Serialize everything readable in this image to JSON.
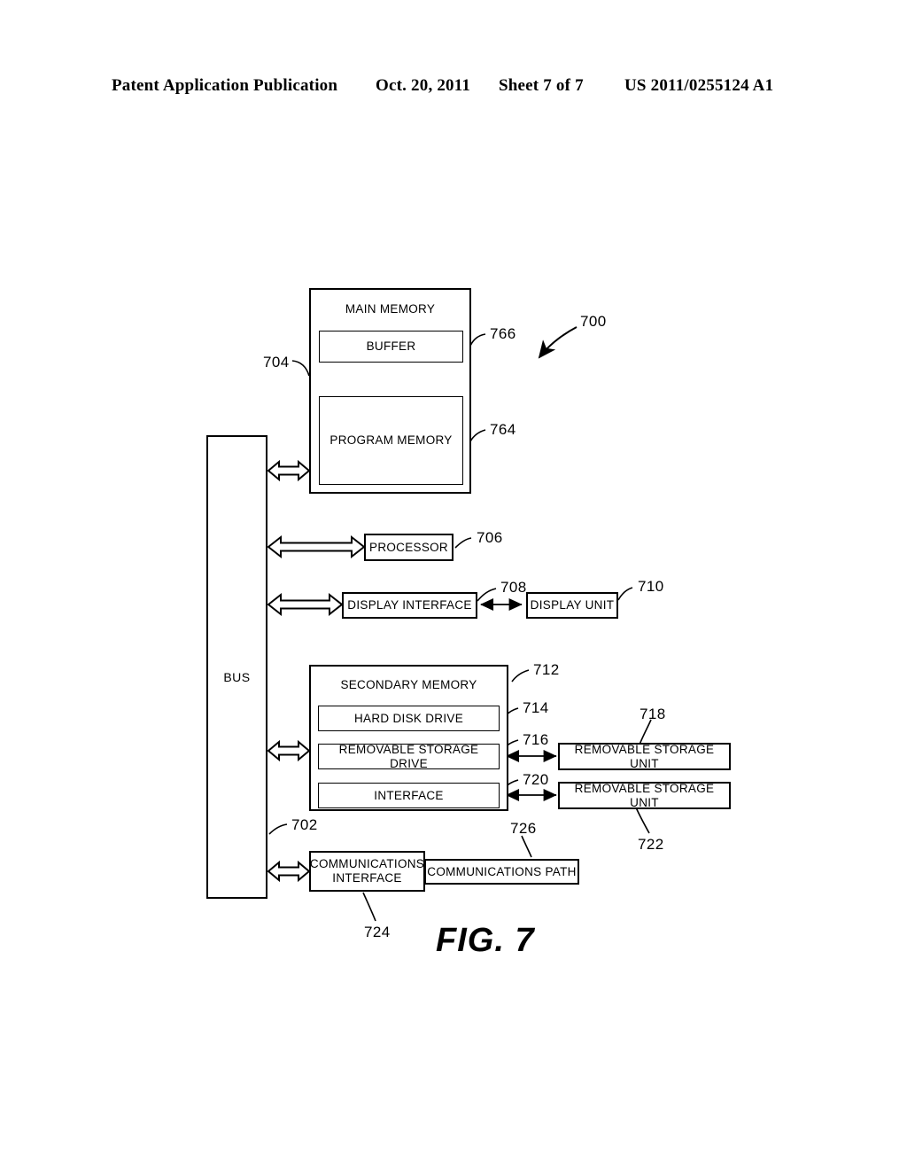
{
  "header": {
    "title": "Patent Application Publication",
    "date": "Oct. 20, 2011",
    "sheet": "Sheet 7 of 7",
    "publication_number": "US 2011/0255124 A1"
  },
  "figure": {
    "caption": "FIG. 7",
    "system_ref": "700",
    "bus": {
      "label": "BUS",
      "ref": "702"
    },
    "blocks": [
      {
        "id": "main_memory",
        "label": "MAIN MEMORY",
        "ref": "704"
      },
      {
        "id": "buffer",
        "label": "BUFFER",
        "ref": "766"
      },
      {
        "id": "program_memory",
        "label": "PROGRAM MEMORY",
        "ref": "764"
      },
      {
        "id": "processor",
        "label": "PROCESSOR",
        "ref": "706"
      },
      {
        "id": "display_interface",
        "label": "DISPLAY INTERFACE",
        "ref": "708"
      },
      {
        "id": "display_unit",
        "label": "DISPLAY UNIT",
        "ref": "710"
      },
      {
        "id": "secondary_memory",
        "label": "SECONDARY MEMORY",
        "ref": "712"
      },
      {
        "id": "hard_disk_drive",
        "label": "HARD DISK DRIVE",
        "ref": "714"
      },
      {
        "id": "removable_drive",
        "label": "REMOVABLE STORAGE DRIVE",
        "ref": "716"
      },
      {
        "id": "interface",
        "label": "INTERFACE",
        "ref": "720"
      },
      {
        "id": "removable_unit_1",
        "label": "REMOVABLE STORAGE UNIT",
        "ref": "718"
      },
      {
        "id": "removable_unit_2",
        "label": "REMOVABLE STORAGE UNIT",
        "ref": "722"
      },
      {
        "id": "comm_interface",
        "label_line1": "COMMUNICATIONS",
        "label_line2": "INTERFACE",
        "ref": "724"
      },
      {
        "id": "comm_path",
        "label": "COMMUNICATIONS PATH",
        "ref": "726"
      }
    ]
  }
}
